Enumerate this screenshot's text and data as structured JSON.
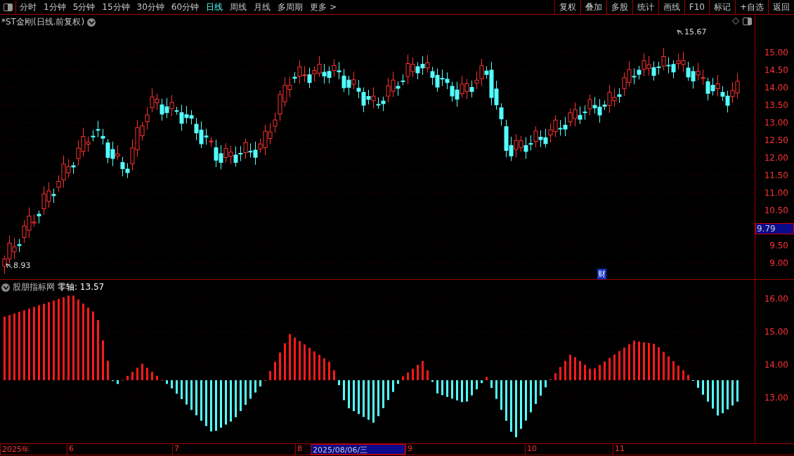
{
  "periods": [
    {
      "label": "分时",
      "selected": false
    },
    {
      "label": "1分钟",
      "selected": false
    },
    {
      "label": "5分钟",
      "selected": false
    },
    {
      "label": "15分钟",
      "selected": false
    },
    {
      "label": "30分钟",
      "selected": false
    },
    {
      "label": "60分钟",
      "selected": false
    },
    {
      "label": "日线",
      "selected": true
    },
    {
      "label": "周线",
      "selected": false
    },
    {
      "label": "月线",
      "selected": false
    },
    {
      "label": "多周期",
      "selected": false
    },
    {
      "label": "更多 >",
      "selected": false
    }
  ],
  "tools": [
    "复权",
    "叠加",
    "多股",
    "统计",
    "画线",
    "F10",
    "标记",
    "+自选",
    "返回"
  ],
  "main_chart": {
    "title": "*ST金刚(日线.前复权)",
    "high_label": "15.67",
    "low_label": "8.93",
    "event_marker": "财",
    "current_price": "9.79",
    "y_ticks": [
      "15.00",
      "14.50",
      "14.00",
      "13.50",
      "13.00",
      "12.50",
      "12.00",
      "11.50",
      "11.00",
      "10.50",
      "9.50",
      "9.00"
    ]
  },
  "indicator": {
    "name": "股朋指标网",
    "line_label": "零轴:",
    "line_value": "13.57",
    "y_ticks": [
      "16.00",
      "15.00",
      "14.00",
      "13.00"
    ]
  },
  "date_axis": {
    "labels": [
      {
        "text": "2025年",
        "selected": false
      },
      {
        "text": "6",
        "selected": false
      },
      {
        "text": "7",
        "selected": false
      },
      {
        "text": "8",
        "selected": false
      },
      {
        "text": "2025/08/06/三",
        "selected": true
      },
      {
        "text": "9",
        "selected": false
      },
      {
        "text": "10",
        "selected": false
      },
      {
        "text": "11",
        "selected": false
      }
    ]
  }
}
